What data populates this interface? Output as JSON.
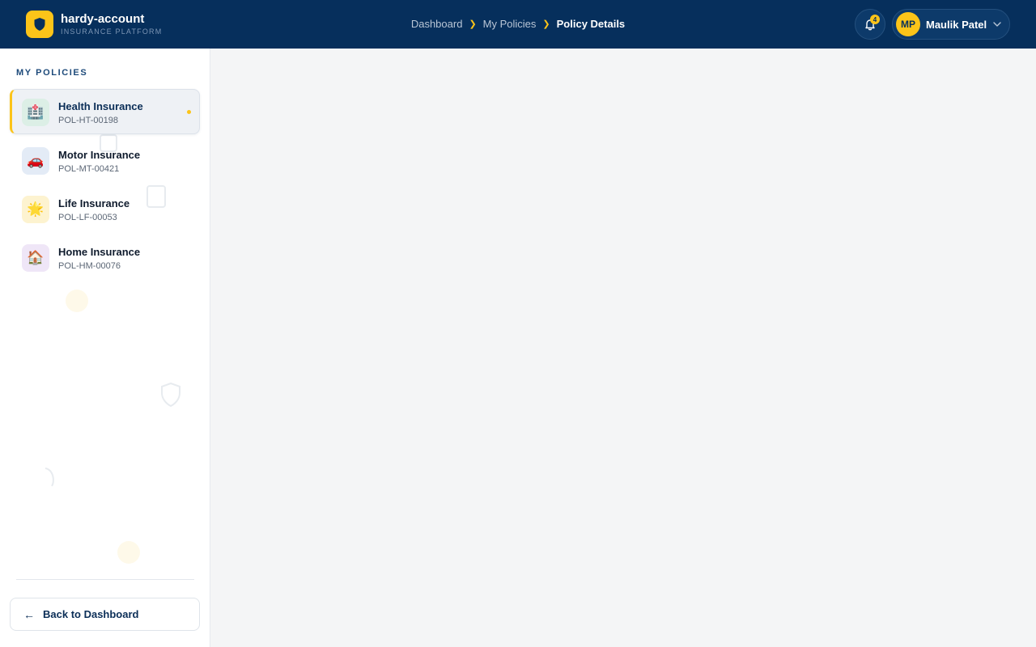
{
  "app": {
    "name": "hardy-account",
    "subtitle": "INSURANCE PLATFORM",
    "accent_color": "#fcc419",
    "header_color": "#062f5c"
  },
  "breadcrumb": {
    "items": [
      "Dashboard",
      "My Policies"
    ],
    "current": "Policy Details",
    "separator": "❯"
  },
  "notifications": {
    "count": "4",
    "icon": "bell-icon"
  },
  "user": {
    "initials": "MP",
    "name": "Maulik Patel"
  },
  "sidebar": {
    "title": "MY POLICIES",
    "policies": [
      {
        "name": "Health Insurance",
        "id": "POL-HT-00198",
        "icon": "🏥",
        "icon_name": "hospital-icon",
        "icon_bg": "#dcefe6",
        "active": true
      },
      {
        "name": "Motor Insurance",
        "id": "POL-MT-00421",
        "icon": "🚗",
        "icon_name": "car-icon",
        "icon_bg": "#e3ebf6",
        "active": false
      },
      {
        "name": "Life Insurance",
        "id": "POL-LF-00053",
        "icon": "🌟",
        "icon_name": "star-icon",
        "icon_bg": "#fdf3d0",
        "active": false
      },
      {
        "name": "Home Insurance",
        "id": "POL-HM-00076",
        "icon": "🏠",
        "icon_name": "house-icon",
        "icon_bg": "#efe6f7",
        "active": false
      }
    ],
    "back_label": "Back to Dashboard",
    "back_arrow": "←"
  }
}
